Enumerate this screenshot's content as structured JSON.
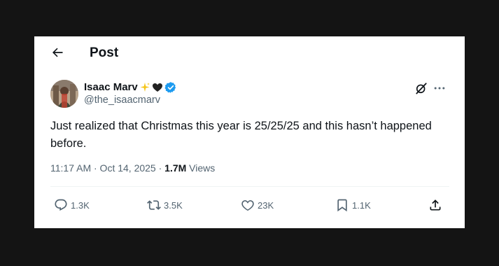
{
  "header": {
    "title": "Post",
    "back_icon": "arrow-left-icon"
  },
  "author": {
    "display_name": "Isaac Marv",
    "name_emojis": [
      "sparkles",
      "black-heart"
    ],
    "verified": true,
    "handle": "@the_isaacmarv"
  },
  "post": {
    "text": "Just realized that Christmas this year is 25/25/25 and this hasn’t happened before.",
    "time": "11:17 AM · Oct 14, 2025 · ",
    "views_count": "1.7M",
    "views_label": " Views"
  },
  "actions": {
    "replies": "1.3K",
    "reposts": "3.5K",
    "likes": "23K",
    "bookmarks": "1.1K"
  },
  "colors": {
    "text": "#0f1419",
    "secondary": "#536471",
    "verified": "#1d9bf0",
    "background": "#ffffff"
  }
}
